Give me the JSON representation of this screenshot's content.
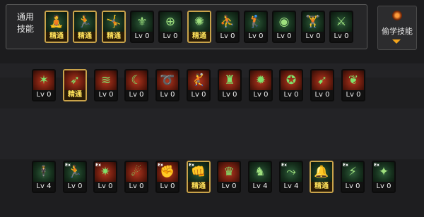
{
  "common_skills": {
    "label": "通用\n技能",
    "slots": [
      {
        "level": "精通",
        "icon": "seated-figure-icon",
        "glyph": "🧘",
        "theme": "green",
        "mastered": true
      },
      {
        "level": "精通",
        "icon": "crouching-figure-icon",
        "glyph": "🏃",
        "theme": "green",
        "mastered": true
      },
      {
        "level": "精通",
        "icon": "running-kick-icon",
        "glyph": "🤸",
        "theme": "green",
        "mastered": true
      },
      {
        "level": "Lv 0",
        "icon": "wings-emblem-icon",
        "glyph": "⚜",
        "theme": "green",
        "mastered": false
      },
      {
        "level": "Lv 0",
        "icon": "crosshair-icon",
        "glyph": "⊕",
        "theme": "green",
        "mastered": false
      },
      {
        "level": "精通",
        "icon": "target-burst-icon",
        "glyph": "✺",
        "theme": "green",
        "mastered": true
      },
      {
        "level": "Lv 0",
        "icon": "kick-figure-icon",
        "glyph": "⛹",
        "theme": "green",
        "mastered": false
      },
      {
        "level": "Lv 0",
        "icon": "aim-figure-icon",
        "glyph": "🏌",
        "theme": "green",
        "mastered": false
      },
      {
        "level": "Lv 0",
        "icon": "eye-ring-icon",
        "glyph": "◉",
        "theme": "green",
        "mastered": false
      },
      {
        "level": "Lv 0",
        "icon": "flexing-figure-icon",
        "glyph": "🏋",
        "theme": "green",
        "mastered": false
      },
      {
        "level": "Lv 0",
        "icon": "sword-figure-icon",
        "glyph": "⚔",
        "theme": "green",
        "mastered": false
      }
    ]
  },
  "steal_skills": {
    "label": "偷学技能",
    "icon": "steal-orb-icon",
    "dropdown_icon": "triangle-down-icon"
  },
  "row_two": [
    {
      "level": "Lv 0",
      "icon": "claw-slash-icon",
      "glyph": "✶",
      "theme": "red",
      "mastered": false
    },
    {
      "level": "精通",
      "icon": "dash-strike-icon",
      "glyph": "➶",
      "theme": "red",
      "mastered": true
    },
    {
      "level": "Lv 0",
      "icon": "triple-slash-icon",
      "glyph": "≋",
      "theme": "red",
      "mastered": false
    },
    {
      "level": "Lv 0",
      "icon": "crescent-slash-icon",
      "glyph": "☾",
      "theme": "red",
      "mastered": false
    },
    {
      "level": "Lv 0",
      "icon": "spiral-slash-icon",
      "glyph": "➰",
      "theme": "red",
      "mastered": false
    },
    {
      "level": "Lv 0",
      "icon": "leap-figure-icon",
      "glyph": "🤾",
      "theme": "red",
      "mastered": false
    },
    {
      "level": "Lv 0",
      "icon": "armored-torso-icon",
      "glyph": "♜",
      "theme": "red",
      "mastered": false
    },
    {
      "level": "Lv 0",
      "icon": "explosion-icon",
      "glyph": "✹",
      "theme": "red",
      "mastered": false
    },
    {
      "level": "Lv 0",
      "icon": "whirlwind-figure-icon",
      "glyph": "✪",
      "theme": "red",
      "mastered": false
    },
    {
      "level": "Lv 0",
      "icon": "arrow-volley-icon",
      "glyph": "➹",
      "theme": "red",
      "mastered": false
    },
    {
      "level": "Lv 0",
      "icon": "beast-claw-icon",
      "glyph": "❦",
      "theme": "red",
      "mastered": false
    }
  ],
  "row_three": [
    {
      "level": "Lv 4",
      "icon": "standing-warrior-icon",
      "glyph": "🕴",
      "theme": "green",
      "mastered": false
    },
    {
      "level": "Lv 0",
      "icon": "sprint-figure-icon",
      "glyph": "🏃",
      "theme": "green",
      "mastered": false,
      "ex": "Ex"
    },
    {
      "level": "Lv 0",
      "icon": "shatter-strike-icon",
      "glyph": "✷",
      "theme": "red",
      "mastered": false,
      "ex": "Ex"
    },
    {
      "level": "Lv 0",
      "icon": "comet-icon",
      "glyph": "☄",
      "theme": "red",
      "mastered": false
    },
    {
      "level": "Lv 0",
      "icon": "fist-burst-icon",
      "glyph": "✊",
      "theme": "red",
      "mastered": false,
      "ex": "Ex"
    },
    {
      "level": "精通",
      "icon": "power-fist-icon",
      "glyph": "👊",
      "theme": "green",
      "mastered": true,
      "ex": "Ex"
    },
    {
      "level": "Lv 0",
      "icon": "spiked-armor-icon",
      "glyph": "♛",
      "theme": "red",
      "mastered": false
    },
    {
      "level": "Lv 4",
      "icon": "muscle-torso-icon",
      "glyph": "♞",
      "theme": "green",
      "mastered": false
    },
    {
      "level": "Lv 4",
      "icon": "charge-figure-icon",
      "glyph": "⤳",
      "theme": "green",
      "mastered": false,
      "ex": "Ex"
    },
    {
      "level": "精通",
      "icon": "bell-shield-icon",
      "glyph": "🔔",
      "theme": "green",
      "mastered": true
    },
    {
      "level": "Lv 0",
      "icon": "lunge-figure-icon",
      "glyph": "⚡",
      "theme": "green",
      "mastered": false,
      "ex": "Ex"
    },
    {
      "level": "Lv 0",
      "icon": "energy-bolt-icon",
      "glyph": "✦",
      "theme": "green",
      "mastered": false,
      "ex": "Ex"
    }
  ]
}
